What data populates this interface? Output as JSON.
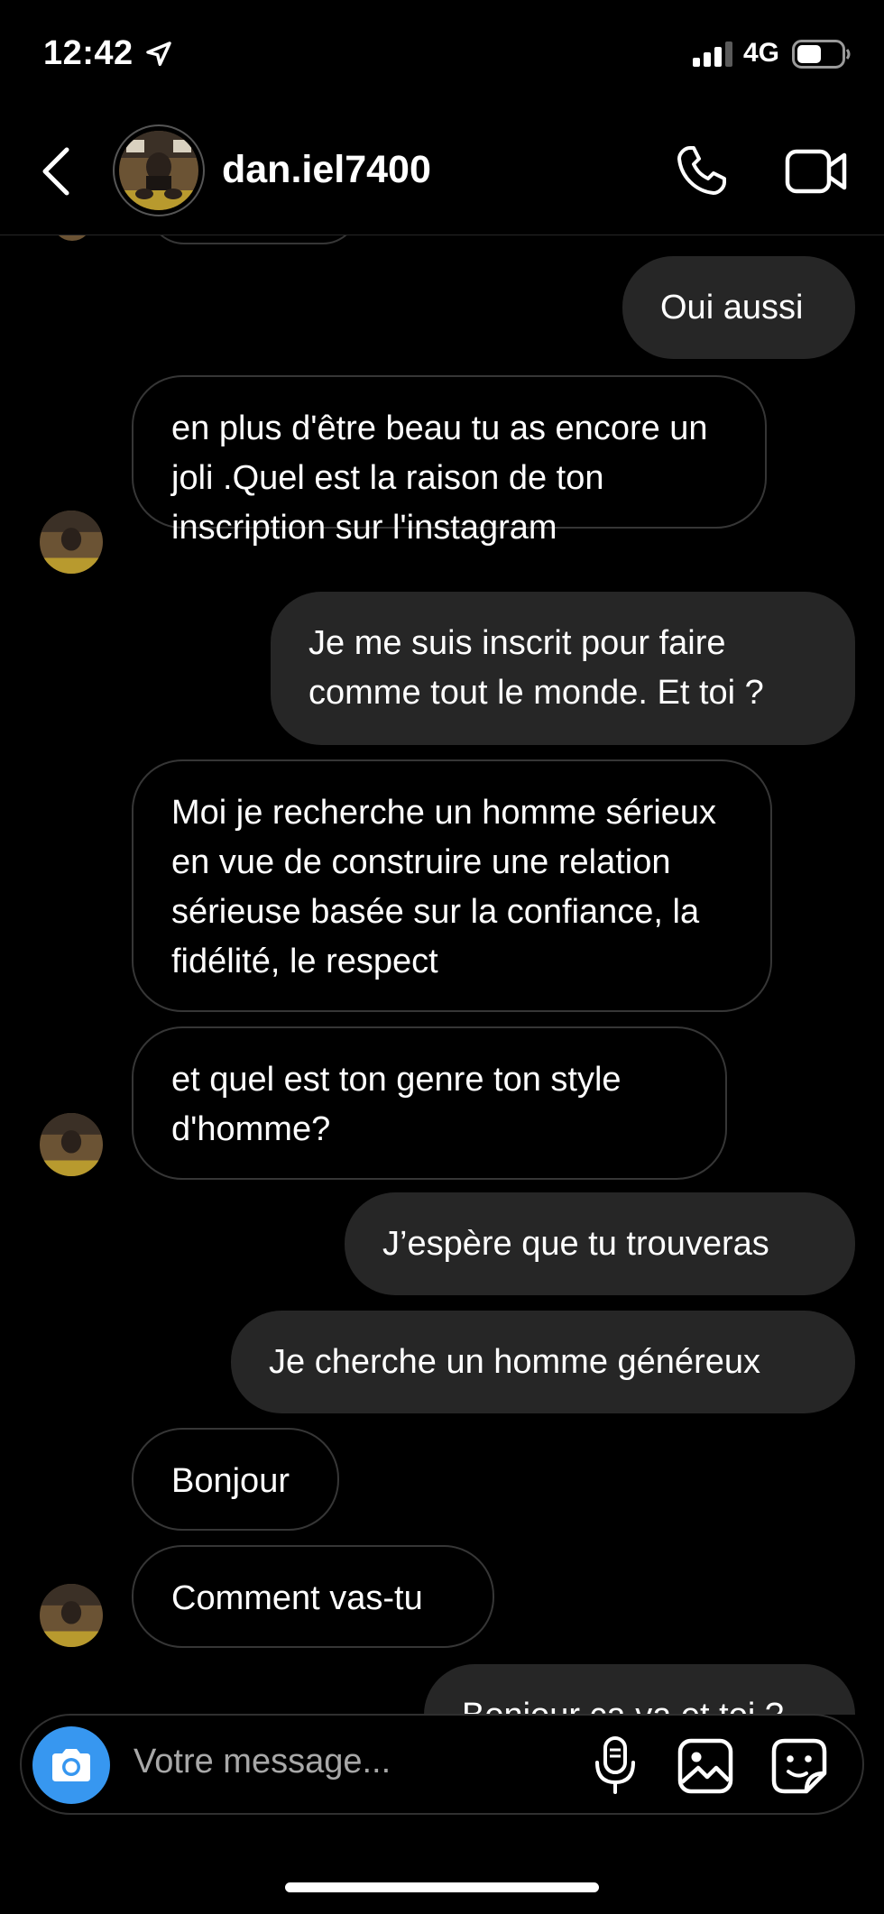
{
  "status": {
    "time": "12:42",
    "network": "4G",
    "battery_level": 0.55
  },
  "header": {
    "username": "dan.iel7400"
  },
  "messages": [
    {
      "side": "out",
      "text": "Oui aussi"
    },
    {
      "side": "in",
      "text": "en plus d'être beau tu as encore un joli .Quel est la raison de ton inscription sur l'instagram"
    },
    {
      "side": "out",
      "text": "Je me suis inscrit pour faire comme tout le monde. Et toi ?"
    },
    {
      "side": "in",
      "text": "Moi je recherche un homme sérieux en vue de construire une relation sérieuse basée sur la confiance, la fidélité, le respect"
    },
    {
      "side": "in",
      "text": "et quel est ton genre ton style d'homme?"
    },
    {
      "side": "out",
      "text": "J’espère que tu trouveras"
    },
    {
      "side": "out",
      "text": "Je cherche un homme généreux"
    },
    {
      "side": "in",
      "text": "Bonjour"
    },
    {
      "side": "in",
      "text": "Comment vas-tu"
    },
    {
      "side": "out",
      "text": "Bonjour ça va et toi ?"
    }
  ],
  "composer": {
    "placeholder": "Votre message..."
  },
  "icons": {
    "back": "chevron-left-icon",
    "call": "phone-icon",
    "video": "video-camera-icon",
    "camera": "camera-icon",
    "mic": "microphone-icon",
    "gallery": "image-icon",
    "sticker": "sticker-icon"
  },
  "colors": {
    "accent": "#3797f0",
    "bubble_out": "#262626",
    "bubble_in_border": "#363636"
  }
}
